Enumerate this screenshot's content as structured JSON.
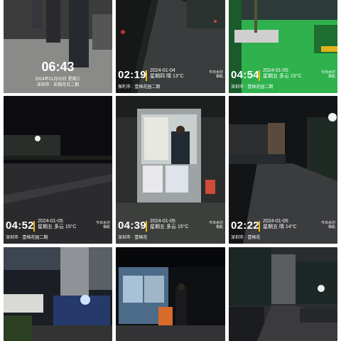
{
  "photos": [
    {
      "time": "06:43",
      "date": "2024年01月03日 星期三",
      "location": "深圳市 · 安福月白二期"
    },
    {
      "time": "02:19",
      "date": "2024-01-04",
      "weather": "星期四 晴 13°C",
      "location": "保利市 · 壹格花园二期",
      "brand": "今日水印\n相机"
    },
    {
      "time": "04:54",
      "date": "2024-01-05",
      "weather": "星期五 多云 15°C",
      "location": "深圳市 · 壹格花园二期",
      "brand": "今日水印\n相机"
    },
    {
      "time": "04:52",
      "date": "2024-01-05",
      "weather": "星期五 多云 15°C",
      "location": "深圳市 · 壹格花园二期",
      "brand": "今日水印\n相机"
    },
    {
      "time": "04:39",
      "date": "2024-01-05",
      "weather": "星期五 多云 15°C",
      "location": "深圳市 · 壹格花",
      "brand": "今日水印\n相机"
    },
    {
      "time": "02:22",
      "date": "2024-01-05",
      "weather": "星期五 晴 14°C",
      "location": "深圳市 · 壹格花",
      "brand": "今日水印\n相机"
    },
    {},
    {},
    {}
  ]
}
